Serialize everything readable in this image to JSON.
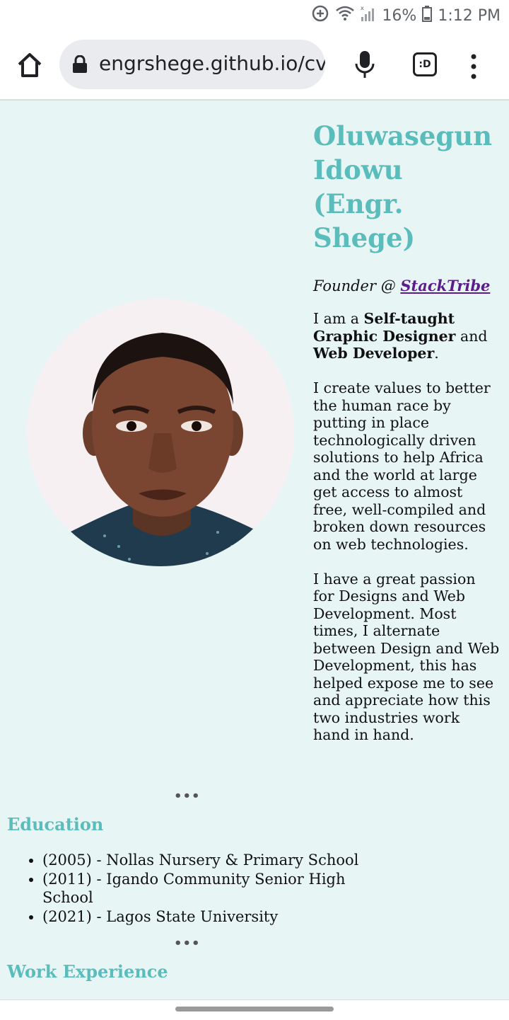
{
  "status_bar": {
    "battery": "16%",
    "time": "1:12 PM",
    "icons": [
      "data-saver-icon",
      "wifi-icon",
      "signal-icon",
      "battery-icon"
    ]
  },
  "browser": {
    "url": "engrshege.github.io/cv",
    "tab_switcher_label": ":D",
    "icons": [
      "home-icon",
      "lock-icon",
      "mic-icon",
      "tab-switcher-icon",
      "more-vert-icon"
    ]
  },
  "profile": {
    "name": "Oluwasegun Idowu (Engr. Shege)",
    "founder_prefix": "Founder @ ",
    "founder_link": "StackTribe",
    "intro_1": "I am a ",
    "intro_bold_1": "Self-taught Graphic Designer",
    "intro_2": " and ",
    "intro_bold_2": "Web Developer",
    "intro_3": ".",
    "para_2": "I create values to better the human race by putting in place technologically driven solutions to help Africa and the world at large get access to almost free, well-compiled and broken down resources on web technologies.",
    "para_3": "I have a great passion for Designs and Web Development. Most times, I alternate between Design and Web Development, this has helped expose me to see and appreciate how this two industries work hand in hand."
  },
  "separator": "•••",
  "education": {
    "title": "Education",
    "items": [
      "(2005) - Nollas Nursery & Primary School",
      "(2011) - Igando Community Senior High School",
      "(2021) - Lagos State University"
    ]
  },
  "work": {
    "title": "Work Experience"
  },
  "colors": {
    "heading": "#5bbcbc",
    "page_bg": "#e8f5f5",
    "link": "#5a1d8a"
  }
}
